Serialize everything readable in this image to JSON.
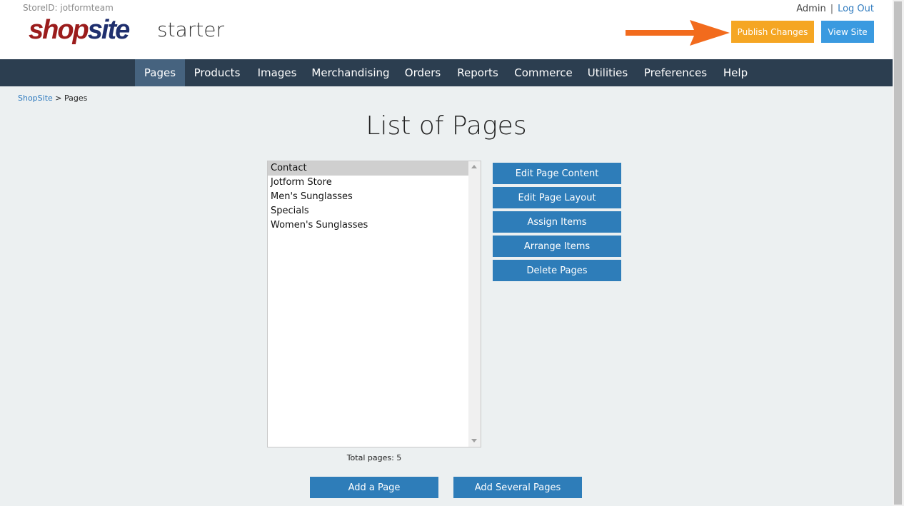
{
  "header": {
    "store_id": "StoreID: jotformteam",
    "logo_shop": "shop",
    "logo_site": "site",
    "logo_starter": "starter",
    "admin_label": "Admin",
    "separator": "|",
    "logout_label": "Log Out",
    "publish_label": "Publish Changes",
    "view_site_label": "View Site",
    "arrow_color": "#f26b1d"
  },
  "nav": {
    "items": [
      "Pages",
      "Products",
      "Images",
      "Merchandising",
      "Orders",
      "Reports",
      "Commerce",
      "Utilities",
      "Preferences",
      "Help"
    ],
    "active": "Pages"
  },
  "breadcrumb": {
    "root": "ShopSite",
    "sep": " > ",
    "current": "Pages"
  },
  "main": {
    "title": "List of Pages",
    "pages": [
      "Contact",
      "Jotform Store",
      "Men's Sunglasses",
      "Specials",
      "Women's Sunglasses"
    ],
    "selected_page": "Contact",
    "total_label": "Total pages: 5",
    "actions": [
      "Edit Page Content",
      "Edit Page Layout",
      "Assign Items",
      "Arrange Items",
      "Delete Pages"
    ],
    "add_page_label": "Add a Page",
    "add_several_label": "Add Several Pages"
  },
  "colors": {
    "nav_bg": "#2c3e50",
    "nav_active": "#46637f",
    "button_blue": "#2e7db9",
    "publish_orange": "#f5a623",
    "view_site_blue": "#3a9ae0"
  }
}
